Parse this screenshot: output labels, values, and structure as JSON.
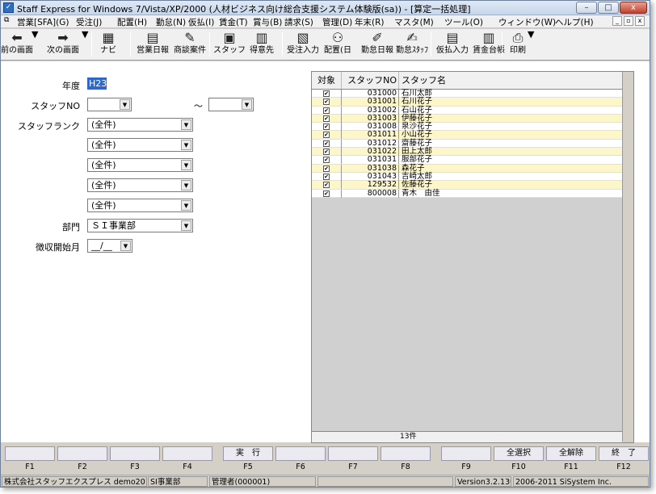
{
  "window": {
    "title": "Staff Express for Windows 7/Vista/XP/2000 (人材ビジネス向け総合支援システム体験版(sa)) - [算定一括処理]",
    "min": "–",
    "max": "□",
    "close": "x"
  },
  "menu": [
    "営業[SFA](G)",
    "受注(J)",
    "配置(H)",
    "勤怠(N)",
    "仮払(I)",
    "賃金(T)",
    "賞与(B)",
    "請求(S)",
    "管理(D)",
    "年末(R)",
    "マスタ(M)",
    "ツール(O)",
    "ウィンドウ(W)",
    "ヘルプ(H)"
  ],
  "mdi": {
    "min": "_",
    "restore": "▫",
    "close": "x"
  },
  "toolbar": [
    {
      "label": "前の画面",
      "icon": "back-arrow-icon",
      "glyph": "⬅"
    },
    {
      "label": "次の画面",
      "icon": "forward-arrow-icon",
      "glyph": "➡"
    },
    {
      "label": "ナビ",
      "icon": "navi-icon",
      "glyph": "▦"
    },
    {
      "label": "営業日報",
      "icon": "sales-report-icon",
      "glyph": "▤"
    },
    {
      "label": "商談案件",
      "icon": "deal-icon",
      "glyph": "✎"
    },
    {
      "label": "スタッフ",
      "icon": "staff-icon",
      "glyph": "▣"
    },
    {
      "label": "得意先",
      "icon": "client-icon",
      "glyph": "▥"
    },
    {
      "label": "受注入力",
      "icon": "order-entry-icon",
      "glyph": "▧"
    },
    {
      "label": "配置(日",
      "icon": "assignment-icon",
      "glyph": "⚇"
    },
    {
      "label": "勤怠日報",
      "icon": "attendance-report-icon",
      "glyph": "✐"
    },
    {
      "label": "勤怠ｽﾀｯﾌ",
      "icon": "attendance-staff-icon",
      "glyph": "✍"
    },
    {
      "label": "仮払入力",
      "icon": "advance-entry-icon",
      "glyph": "▤"
    },
    {
      "label": "賃金台帳",
      "icon": "wage-ledger-icon",
      "glyph": "▥"
    },
    {
      "label": "印刷",
      "icon": "print-icon",
      "glyph": "⎙"
    }
  ],
  "form": {
    "year_label": "年度",
    "year_value": "H23",
    "staffno_label": "スタッフNO",
    "range_sep": "～",
    "rank_label": "スタッフランク",
    "rank_values": [
      "(全件)",
      "(全件)",
      "(全件)",
      "(全件)",
      "(全件)"
    ],
    "dept_label": "部門",
    "dept_value": "ＳＩ事業部",
    "collect_label": "徴収開始月",
    "collect_value": "__/__"
  },
  "grid": {
    "headers": [
      "対象",
      "スタッフNO",
      "スタッフ名"
    ],
    "check": "✔",
    "rows": [
      {
        "no": "031000",
        "name": "石川太郎",
        "hl": false
      },
      {
        "no": "031001",
        "name": "石川花子",
        "hl": true
      },
      {
        "no": "031002",
        "name": "石山花子",
        "hl": false
      },
      {
        "no": "031003",
        "name": "伊藤花子",
        "hl": true
      },
      {
        "no": "031008",
        "name": "泉沙花子",
        "hl": false
      },
      {
        "no": "031011",
        "name": "小山花子",
        "hl": true
      },
      {
        "no": "031012",
        "name": "齋藤花子",
        "hl": false
      },
      {
        "no": "031022",
        "name": "田上太郎",
        "hl": true
      },
      {
        "no": "031031",
        "name": "服部花子",
        "hl": false
      },
      {
        "no": "031038",
        "name": "森花子",
        "hl": true
      },
      {
        "no": "031043",
        "name": "吉崎太郎",
        "hl": false
      },
      {
        "no": "129532",
        "name": "佐藤花子",
        "hl": true
      },
      {
        "no": "800008",
        "name": "青木　由佳",
        "hl": false
      }
    ],
    "count": "13件"
  },
  "fkeys": [
    {
      "key": "F1",
      "label": ""
    },
    {
      "key": "F2",
      "label": ""
    },
    {
      "key": "F3",
      "label": ""
    },
    {
      "key": "F4",
      "label": ""
    },
    {
      "key": "F5",
      "label": "実　行"
    },
    {
      "key": "F6",
      "label": ""
    },
    {
      "key": "F7",
      "label": ""
    },
    {
      "key": "F8",
      "label": ""
    },
    {
      "key": "F9",
      "label": ""
    },
    {
      "key": "F10",
      "label": "全選択"
    },
    {
      "key": "F11",
      "label": "全解除"
    },
    {
      "key": "F12",
      "label": "終　了"
    }
  ],
  "status": [
    "株式会社スタッフエクスプレス demo201101",
    "SI事業部",
    "管理者(000001)",
    "",
    "Version3.2.130",
    "2006-2011 SiSystem Inc."
  ]
}
